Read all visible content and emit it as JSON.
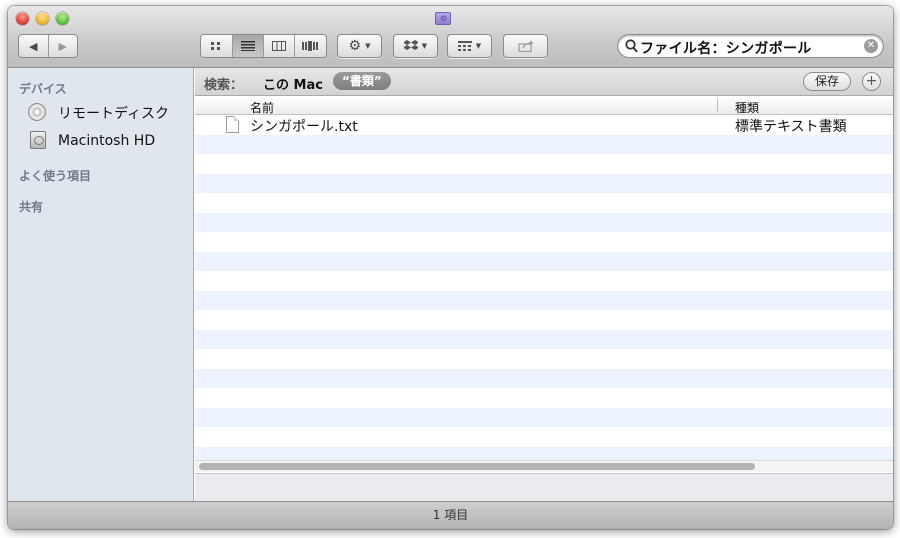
{
  "toolbar": {
    "back_icon": "chevron-left-icon",
    "forward_icon": "chevron-right-icon",
    "view_modes": [
      "icon-view",
      "list-view",
      "column-view",
      "coverflow-view"
    ],
    "active_view": "list-view",
    "action_icon": "gear-icon",
    "dropbox_icon": "dropbox-icon",
    "arrange_icon": "arrange-icon",
    "share_icon": "share-icon"
  },
  "search": {
    "value": "ファイル名：シンガポール",
    "clear_icon": "clear-icon"
  },
  "sidebar": {
    "devices_header": "デバイス",
    "devices": [
      {
        "label": "リモートディスク",
        "icon": "optical-disc-icon"
      },
      {
        "label": "Macintosh HD",
        "icon": "hard-drive-icon"
      }
    ],
    "favorites_header": "よく使う項目",
    "shared_header": "共有"
  },
  "searchbar": {
    "label": "検索：",
    "scope_mac": "この Mac",
    "scope_docs": "“書類”",
    "save_label": "保存",
    "add_label": "+"
  },
  "columns": {
    "name": "名前",
    "kind": "種類"
  },
  "files": [
    {
      "name": "シンガポール.txt",
      "kind": "標準テキスト書類",
      "icon": "text-file-icon"
    }
  ],
  "status": {
    "count": "1 項目"
  },
  "colors": {
    "sidebar_bg": "#e0e6ee",
    "alt_row": "#edf3fe",
    "sidebar_header": "#6e7b8b"
  }
}
